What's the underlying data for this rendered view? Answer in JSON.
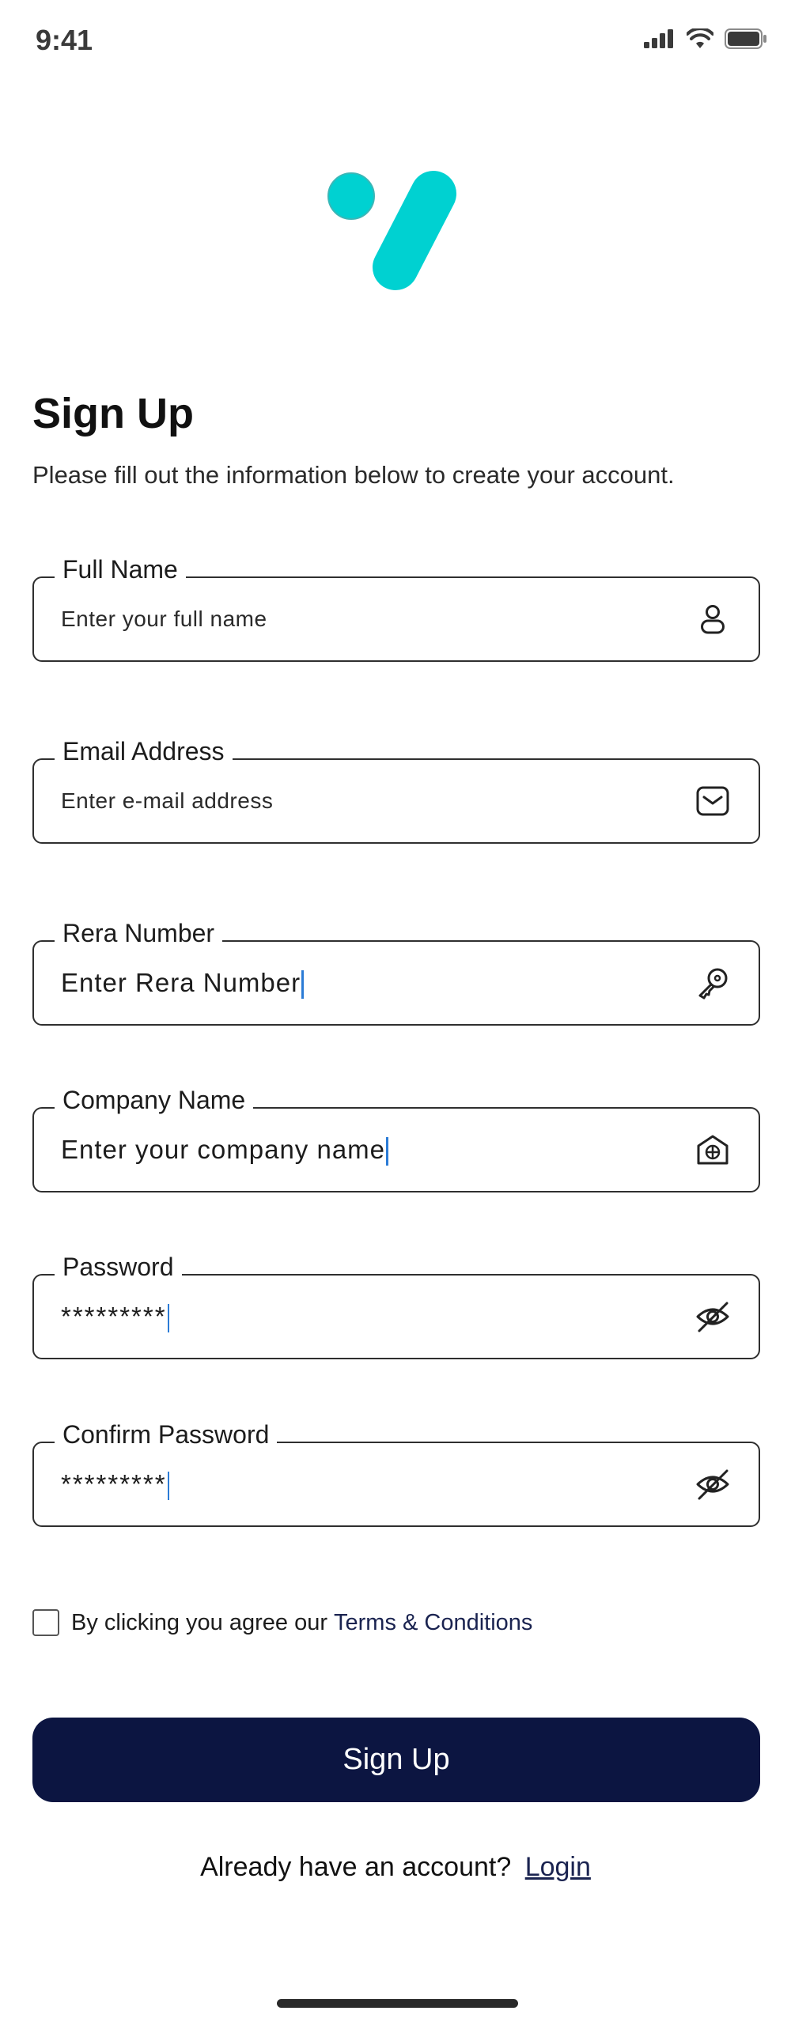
{
  "status_bar": {
    "time": "9:41",
    "icons": [
      "cellular-signal-icon",
      "wifi-icon",
      "battery-icon"
    ]
  },
  "brand": {
    "accent_color": "#00d1d1",
    "logo_icon": "brand-logo-icon"
  },
  "header": {
    "title": "Sign Up",
    "subtitle": "Please fill out the information below to create your account."
  },
  "form": {
    "full_name": {
      "label": "Full Name",
      "placeholder": "Enter your full name",
      "icon": "user-icon"
    },
    "email": {
      "label": "Email Address",
      "placeholder": "Enter e-mail address",
      "icon": "mail-icon"
    },
    "rera": {
      "label": "Rera Number",
      "value": "Enter Rera Number",
      "icon": "key-icon"
    },
    "company": {
      "label": "Company Name",
      "value": "Enter your company name",
      "icon": "building-icon"
    },
    "password": {
      "label": "Password",
      "value": "*********",
      "icon": "eye-off-icon"
    },
    "confirm_password": {
      "label": "Confirm Password",
      "value": "*********",
      "icon": "eye-off-icon"
    }
  },
  "terms": {
    "checked": false,
    "text": "By clicking you agree our",
    "link_label": "Terms & Conditions"
  },
  "submit": {
    "label": "Sign Up",
    "color": "#0c1541"
  },
  "footer": {
    "prompt": "Already have an account?",
    "login_label": "Login"
  }
}
